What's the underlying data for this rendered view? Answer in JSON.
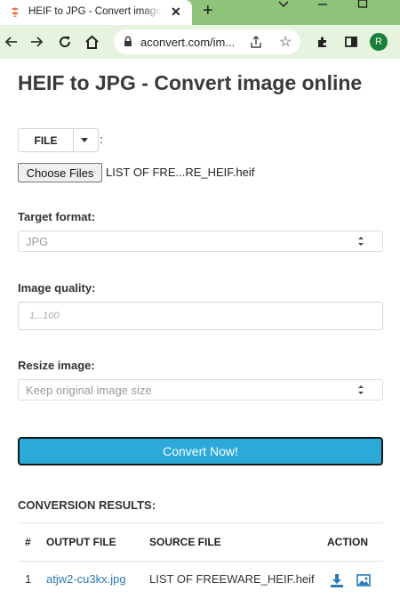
{
  "browser": {
    "tab_title": "HEIF to JPG - Convert image online",
    "close_glyph": "✕",
    "new_tab_glyph": "+",
    "url": "aconvert.com/im...",
    "profile_initial": "R"
  },
  "page": {
    "title": "HEIF to JPG - Convert image online"
  },
  "source": {
    "type_button": "FILE",
    "colon": ":",
    "choose_files": "Choose Files",
    "selected_file": "LIST OF FRE...RE_HEIF.heif"
  },
  "target_format": {
    "label": "Target format:",
    "value": "JPG"
  },
  "image_quality": {
    "label": "Image quality:",
    "placeholder": "1...100"
  },
  "resize": {
    "label": "Resize image:",
    "value": "Keep original image size"
  },
  "convert_button": "Convert Now!",
  "results": {
    "title": "CONVERSION RESULTS:",
    "columns": [
      "#",
      "OUTPUT FILE",
      "SOURCE FILE",
      "ACTION"
    ],
    "rows": [
      {
        "index": "1",
        "output_file": "atjw2-cu3kx.jpg",
        "source_file": "LIST OF FREEWARE_HEIF.heif"
      }
    ]
  },
  "colors": {
    "accent": "#2ba9d9",
    "link": "#2a7ab8",
    "tab_strip": "#8fc37a",
    "toolbar": "#e6f3de"
  },
  "icons": [
    "favicon-icon",
    "close-icon",
    "new-tab-icon",
    "back-icon",
    "forward-icon",
    "reload-icon",
    "home-icon",
    "lock-icon",
    "share-icon",
    "bookmark-star-icon",
    "extensions-icon",
    "sidepanel-icon",
    "download-icon",
    "image-icon"
  ]
}
